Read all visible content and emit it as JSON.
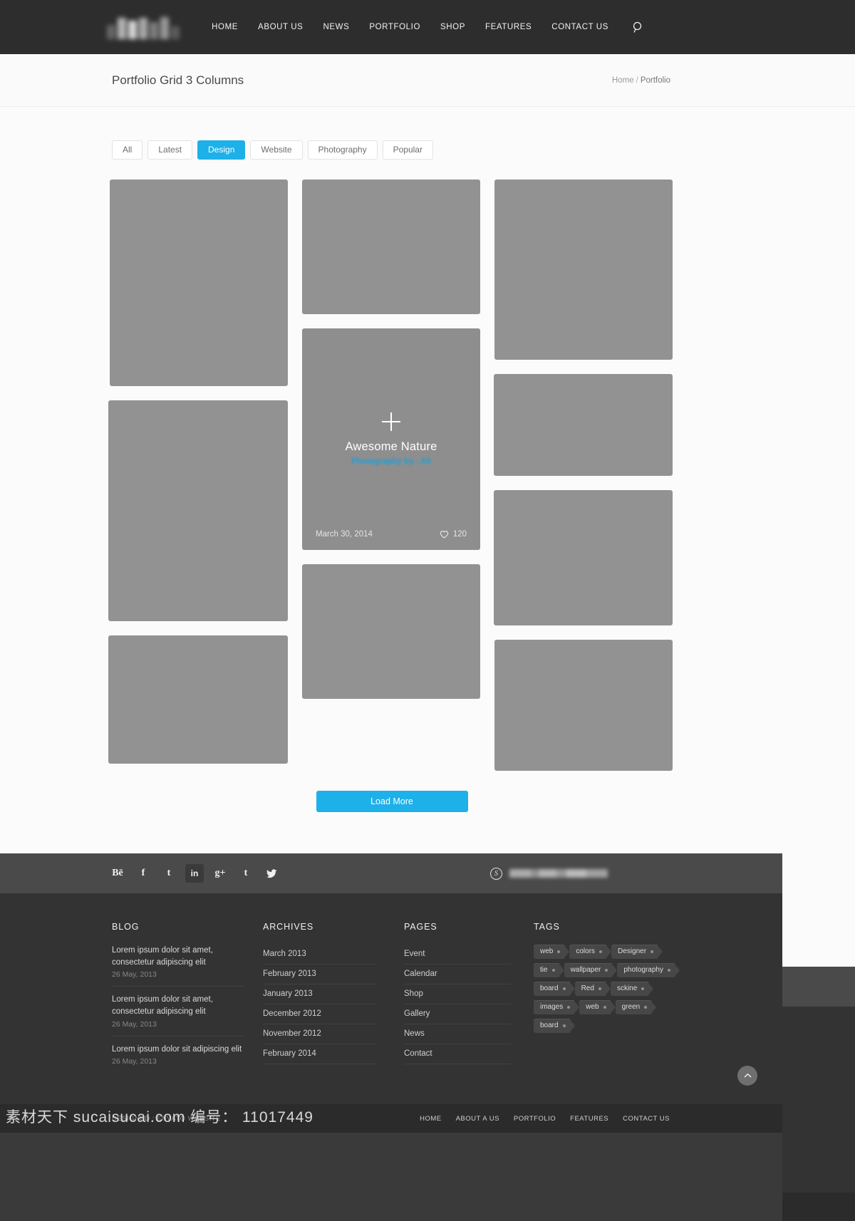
{
  "header": {
    "logo_alt": "site-logo",
    "nav": [
      {
        "label": "HOME"
      },
      {
        "label": "ABOUT US"
      },
      {
        "label": "NEWS"
      },
      {
        "label": "PORTFOLIO"
      },
      {
        "label": "SHOP"
      },
      {
        "label": "FEATURES"
      },
      {
        "label": "CONTACT US"
      }
    ],
    "search_icon": "search-icon"
  },
  "titlebar": {
    "title": "Portfolio Grid 3 Columns",
    "breadcrumb_home": "Home",
    "breadcrumb_sep": "/",
    "breadcrumb_current": "Portfolio"
  },
  "filters": [
    {
      "label": "All",
      "active": false
    },
    {
      "label": "Latest",
      "active": false
    },
    {
      "label": "Design",
      "active": true
    },
    {
      "label": "Website",
      "active": false
    },
    {
      "label": "Photography",
      "active": false
    },
    {
      "label": "Popular",
      "active": false
    }
  ],
  "hover_card": {
    "title": "Awesome Nature",
    "subtitle": "Photography by : Ali",
    "date": "March 30, 2014",
    "likes": "120",
    "plus_icon": "plus-icon",
    "heart_icon": "heart-icon"
  },
  "load_more": "Load More",
  "social": {
    "items": [
      {
        "name": "behance-icon",
        "glyph": "Bē"
      },
      {
        "name": "facebook-icon",
        "glyph": "f"
      },
      {
        "name": "twitter-alt-icon",
        "glyph": "t"
      },
      {
        "name": "linkedin-icon",
        "glyph": "in",
        "active": true
      },
      {
        "name": "google-plus-icon",
        "glyph": "g+"
      },
      {
        "name": "tumblr-icon",
        "glyph": "t"
      },
      {
        "name": "twitter-icon",
        "glyph": "bird"
      }
    ],
    "skype_icon": "skype-icon"
  },
  "footer": {
    "blog": {
      "heading": "BLOG",
      "items": [
        {
          "title": "Lorem ipsum dolor sit amet, consectetur adipiscing elit",
          "date": "26 May, 2013"
        },
        {
          "title": "Lorem ipsum dolor sit amet, consectetur adipiscing elit",
          "date": "26 May, 2013"
        },
        {
          "title": "Lorem ipsum dolor sit adipiscing elit",
          "date": "26 May, 2013"
        }
      ]
    },
    "archives": {
      "heading": "ARCHIVES",
      "items": [
        "March 2013",
        "February 2013",
        "January 2013",
        "December 2012",
        "November 2012",
        "February 2014"
      ]
    },
    "pages": {
      "heading": "PAGES",
      "items": [
        "Event",
        "Calendar",
        "Shop",
        "Gallery",
        "News",
        "Contact"
      ]
    },
    "tags": {
      "heading": "TAGS",
      "items": [
        "web",
        "colors",
        "Designer",
        "tie",
        "wallpaper",
        "photography",
        "board",
        "Red",
        "sckine",
        "images",
        "web",
        "green",
        "board"
      ]
    }
  },
  "bottom": {
    "copyright": "DESIGNED : ENVATO WEBSITE",
    "nav": [
      "HOME",
      "ABOUT A US",
      "PORTFOLIO",
      "FEATURES",
      "CONTACT US"
    ],
    "to_top_icon": "chevron-up-icon"
  },
  "watermark": "素材天下 sucaisucai.com 编号： 11017449",
  "colors": {
    "accent": "#1eb0e8",
    "header_bg": "#2d2d2d",
    "footer_bg": "#333333",
    "tile": "#929292"
  }
}
